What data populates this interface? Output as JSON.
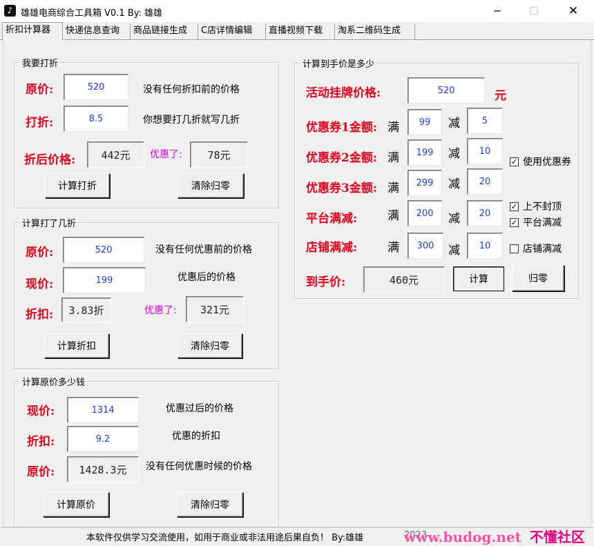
{
  "window": {
    "title": "雄雄电商综合工具箱 V0.1   By:  雄雄",
    "min_icon": "─",
    "max_icon": "☐",
    "close_icon": "✕"
  },
  "tabs": [
    "折扣计算器",
    "快递信息查询",
    "商品链接生成",
    "C店详情编辑",
    "直播视频下载",
    "淘系二维码生成"
  ],
  "discount": {
    "title": "我要打折",
    "price_label": "原价:",
    "price_value": "520",
    "price_hint": "没有任何折扣前的价格",
    "rate_label": "打折:",
    "rate_value": "8.5",
    "rate_hint": "你想要打几折就写几折",
    "result_label": "折后价格:",
    "result_value": "442元",
    "saved_label": "优惠了:",
    "saved_value": "78元",
    "calc_button": "计算打折",
    "clear_button": "清除归零"
  },
  "rate_calc": {
    "title": "计算打了几折",
    "orig_label": "原价:",
    "orig_value": "520",
    "orig_hint": "没有任何优惠前的价格",
    "now_label": "现价:",
    "now_value": "199",
    "now_hint": "优惠后的价格",
    "rate_label": "折扣:",
    "rate_value": "3.83折",
    "saved_label": "优惠了:",
    "saved_value": "321元",
    "calc_button": "计算折扣",
    "clear_button": "清除归零"
  },
  "orig_calc": {
    "title": "计算原价多少钱",
    "now_label": "现价:",
    "now_value": "1314",
    "now_hint": "优惠过后的价格",
    "rate_label": "折扣:",
    "rate_value": "9.2",
    "rate_hint": "优惠的折扣",
    "orig_label": "原价:",
    "orig_value": "1428.3元",
    "orig_hint": "没有任何优惠时候的价格",
    "calc_button": "计算原价",
    "clear_button": "清除归零"
  },
  "final_price": {
    "title": "计算到手价是多少",
    "list_label": "活动挂牌价格:",
    "list_value": "520",
    "yuan": "元",
    "man": "满",
    "jian": "减",
    "rows": [
      {
        "label": "优惠券1金额:",
        "full": "99",
        "minus": "5"
      },
      {
        "label": "优惠券2金额:",
        "full": "199",
        "minus": "10"
      },
      {
        "label": "优惠券3金额:",
        "full": "299",
        "minus": "20"
      },
      {
        "label": "平台满减:",
        "full": "200",
        "minus": "20"
      },
      {
        "label": "店铺满减:",
        "full": "300",
        "minus": "10"
      }
    ],
    "checkboxes": [
      {
        "label": "使用优惠券",
        "checked": true,
        "mark": "✓"
      },
      {
        "label": "上不封顶",
        "checked": true,
        "mark": "✓"
      },
      {
        "label": "平台满减",
        "checked": true,
        "mark": "✓"
      },
      {
        "label": "店铺满减",
        "checked": false,
        "mark": ""
      }
    ],
    "result_label": "到手价:",
    "result_value": "460元",
    "calc_button": "计算",
    "clear_button": "归零"
  },
  "status": {
    "text": "本软件仅供学习交流使用，如用于商业或非法用途后果自负！ By:雄雄",
    "year": "2023",
    "watermark_url": "www.budog.net",
    "watermark_name": "不懂社区"
  }
}
